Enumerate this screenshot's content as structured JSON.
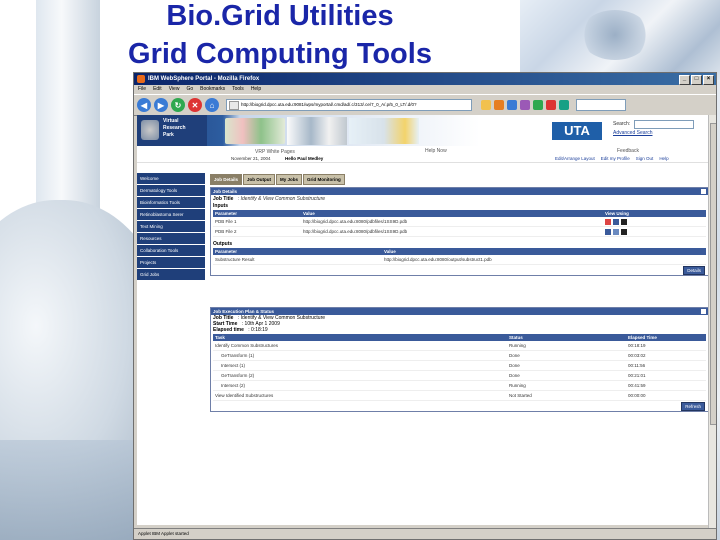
{
  "slide": {
    "title_line1": "Bio.Grid Utilities",
    "title_line2": "Grid Computing Tools"
  },
  "browser": {
    "window_title": "IBM WebSphere Portal - Mozilla Firefox",
    "menu": [
      "File",
      "Edit",
      "View",
      "Go",
      "Bookmarks",
      "Tools",
      "Help"
    ],
    "url": "http://biogrid.dpcc.uta.edu:9081/wps/myportal/.cmd/ad/.c/313/.ce/7_0_A/.p/5_0_LT/.d/0?"
  },
  "portal": {
    "org_line1": "Virtual",
    "org_line2": "Research",
    "org_line3": "Park",
    "uta_logo": "UTA",
    "search_label": "Search:",
    "advanced_search": "Advanced Search",
    "white_pages": "VRP White Pages",
    "help": "Help Now",
    "feedback": "Feedback",
    "date": "November 21, 2004",
    "greeting": "Hello Paul Medley",
    "links": [
      "Edit/Arrange Layout",
      "Edit my Profile",
      "Sign Out",
      "Help"
    ]
  },
  "sidebar": {
    "items": [
      "Welcome",
      "Dermatology Tools",
      "Bioinformatics Tools",
      "Retinoblastoma Serer",
      "Text Mining",
      "Resources",
      "Collaboration Tools",
      "Projects",
      "Grid Jobs"
    ]
  },
  "tabs": [
    "Job Details",
    "Job Output",
    "My Jobs",
    "Grid Monitoring"
  ],
  "job_details": {
    "panel_title": "Job Details",
    "job_title_label": "Job Title",
    "job_title_value": ": Identify & View Common Substructure",
    "inputs_label": "Inputs",
    "inputs_headers": [
      "Parameter",
      "Value",
      "View Using"
    ],
    "inputs_rows": [
      {
        "param": "PDB File 1",
        "value": "http://biogrid.dpcc.uta.edu:8080/pdbfiles/1SS9D.pdb"
      },
      {
        "param": "PDB File 2",
        "value": "http://biogrid.dpcc.uta.edu:8080/pdbfiles/1SS9D.pdb"
      }
    ],
    "outputs_label": "Outputs",
    "outputs_headers": [
      "Parameter",
      "Value"
    ],
    "outputs_rows": [
      {
        "param": "Substructure Result",
        "value": "http://biogrid.dpcc.uta.edu:8080/output/substruct1.pdb"
      }
    ],
    "button": "Details"
  },
  "execution": {
    "panel_title": "Job Execution Plan & Status",
    "job_title_label": "Job Title",
    "job_title_value": ": Identify & View Common Substructure",
    "start_time_label": "Start Time",
    "start_time_value": ": 10th Apr 1 2009",
    "elapsed_label": "Elapsed time",
    "elapsed_value": ": 0:18:19",
    "headers": [
      "Task",
      "Status",
      "Elapsed Time"
    ],
    "rows": [
      {
        "task": "Identify Common Substructures",
        "status": "Running",
        "time": "00:18:19"
      },
      {
        "task": "GeTransform (1)",
        "status": "Done",
        "time": "00:03:02"
      },
      {
        "task": "Intersect (1)",
        "status": "Done",
        "time": "00:11:56"
      },
      {
        "task": "GeTransform (2)",
        "status": "Done",
        "time": "00:21:01"
      },
      {
        "task": "Intersect (2)",
        "status": "Running",
        "time": "00:41:59"
      },
      {
        "task": "View Identified Substructures",
        "status": "Not Started",
        "time": "00:00:00"
      }
    ],
    "button": "Refresh"
  },
  "status_text": "Applet IBM Applet started"
}
